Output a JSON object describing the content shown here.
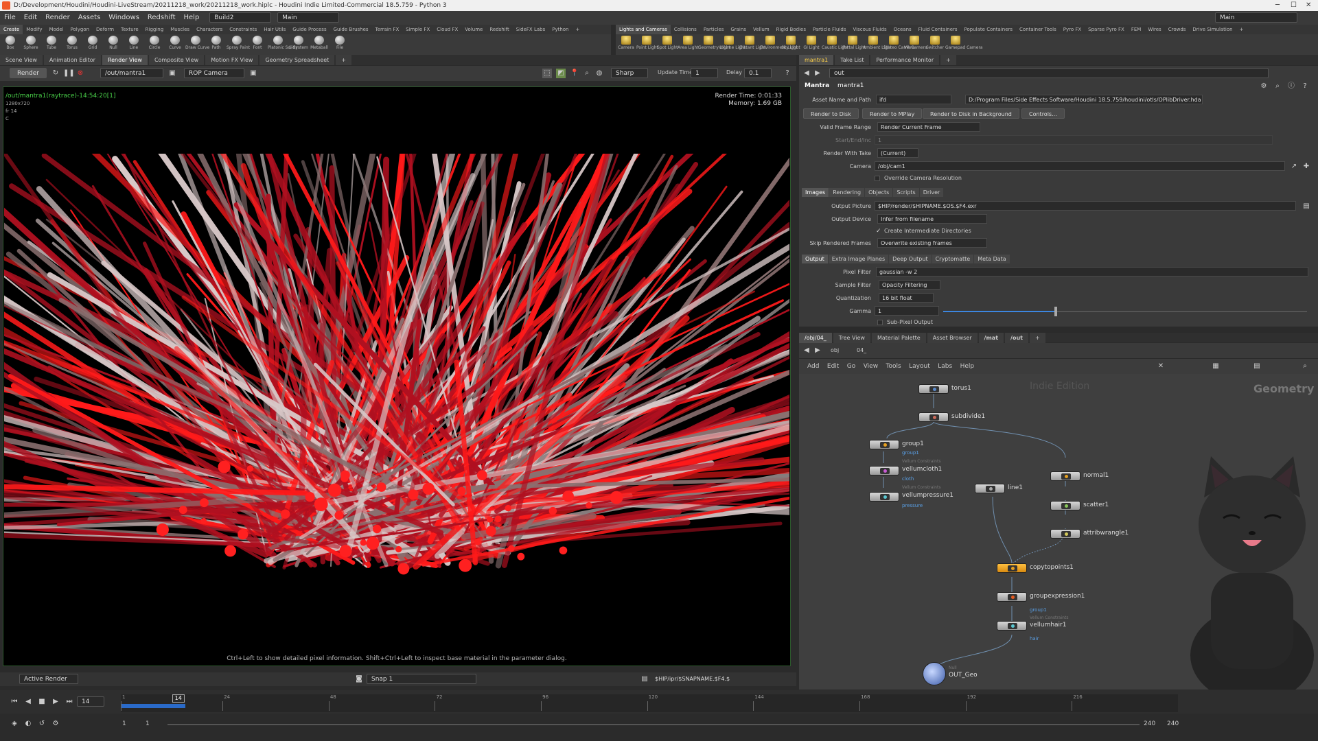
{
  "window": {
    "title": "D:/Development/Houdini/Houdini-LiveStream/20211218_work/20211218_work.hiplc - Houdini Indie Limited-Commercial 18.5.759 - Python 3"
  },
  "menu": {
    "items": [
      "File",
      "Edit",
      "Render",
      "Assets",
      "Windows",
      "Redshift",
      "Help"
    ],
    "desktop": "Build2",
    "context": "Main",
    "right_desktop": "Main"
  },
  "shelf_tabs_left": [
    "Create",
    "Modify",
    "Model",
    "Polygon",
    "Deform",
    "Texture",
    "Rigging",
    "Muscles",
    "Characters",
    "Constraints",
    "Hair Utils",
    "Guide Process",
    "Guide Brushes",
    "Terrain FX",
    "Simple FX",
    "Cloud FX",
    "Volume",
    "Redshift",
    "SideFX Labs",
    "Python"
  ],
  "shelf_tabs_right": [
    "Lights and Cameras",
    "Collisions",
    "Particles",
    "Grains",
    "Vellum",
    "Rigid Bodies",
    "Particle Fluids",
    "Viscous Fluids",
    "Oceans",
    "Fluid Containers",
    "Populate Containers",
    "Container Tools",
    "Pyro FX",
    "Sparse Pyro FX",
    "FEM",
    "Wires",
    "Crowds",
    "Drive Simulation"
  ],
  "shelf_tools_left": [
    "Box",
    "Sphere",
    "Tube",
    "Torus",
    "Grid",
    "Null",
    "Line",
    "Circle",
    "Curve",
    "Draw Curve",
    "Path",
    "Spray Paint",
    "Font",
    "Platonic Solids",
    "L-System",
    "Metaball",
    "File"
  ],
  "shelf_tools_right": [
    "Camera",
    "Point Light",
    "Spot Light",
    "Area Light",
    "Geometry Light",
    "Volume Light",
    "Distant Light",
    "Environment Light",
    "Sky Light",
    "GI Light",
    "Caustic Light",
    "Portal Light",
    "Ambient Light",
    "Stereo Camera",
    "VR Camera",
    "Switcher",
    "Gamepad Camera"
  ],
  "pane_tabs_left": [
    "Scene View",
    "Animation Editor",
    "Render View",
    "Composite View",
    "Motion FX View",
    "Geometry Spreadsheet"
  ],
  "pane_tabs_right": [
    "mantra1",
    "Take List",
    "Performance Monitor"
  ],
  "viewer": {
    "render_label": "Render",
    "rop_path": "/out/mantra1",
    "camera": "ROP Camera",
    "sharp": "Sharp",
    "update_time_label": "Update Time",
    "update_time": "1",
    "delay_label": "Delay",
    "delay": "0.1",
    "info_line1": "/out/mantra1(raytrace)-14:54:20[1]",
    "info_line2": "1280x720",
    "info_line3": "fr 14",
    "info_line4": "C",
    "render_time": "Render Time: 0:01:33",
    "memory": "Memory:      1.69 GB",
    "hint": "Ctrl+Left to show detailed pixel information. Shift+Ctrl+Left to inspect base material in the parameter dialog.",
    "footer_mode": "Active Render",
    "snap": "Snap 1",
    "ipr_path": "$HIP/ipr/$SNAPNAME.$F4.$"
  },
  "params": {
    "path": "out",
    "node_type": "Mantra",
    "node_name": "mantra1",
    "asset_label": "Asset Name and Path",
    "asset_value": "ifd",
    "asset_path": "D:/Program Files/Side Effects Software/Houdini 18.5.759/houdini/otls/OPlibDriver.hda",
    "buttons": [
      "Render to Disk",
      "Render to MPlay",
      "Render to Disk in Background",
      "Controls..."
    ],
    "rows": [
      {
        "label": "Valid Frame Range",
        "value": "Render Current Frame"
      },
      {
        "label": "Start/End/Inc",
        "value": "1"
      },
      {
        "label": "Render With Take",
        "value": "(Current)"
      },
      {
        "label": "Camera",
        "value": "/obj/cam1"
      }
    ],
    "override_cam": "Override Camera Resolution",
    "tabs1": [
      "Images",
      "Rendering",
      "Objects",
      "Scripts",
      "Driver"
    ],
    "output_picture_label": "Output Picture",
    "output_picture": "$HIP/render/$HIPNAME.$OS.$F4.exr",
    "output_device_label": "Output Device",
    "output_device": "Infer from filename",
    "create_dirs": "Create Intermediate Directories",
    "skip_label": "Skip Rendered Frames",
    "skip_value": "Overwrite existing frames",
    "tabs2": [
      "Output",
      "Extra Image Planes",
      "Deep Output",
      "Cryptomatte",
      "Meta Data"
    ],
    "pixel_filter_label": "Pixel Filter",
    "pixel_filter": "gaussian -w 2",
    "sample_filter_label": "Sample Filter",
    "sample_filter": "Opacity Filtering",
    "quant_label": "Quantization",
    "quant": "16 bit float",
    "gamma_label": "Gamma",
    "gamma": "1",
    "gamma_level": 0.31,
    "subpixel": "Sub-Pixel Output"
  },
  "net": {
    "tabs": [
      "/obj/04_",
      "Tree View",
      "Material Palette",
      "Asset Browser",
      "/mat",
      "/out"
    ],
    "path1": "obj",
    "path2": "04_",
    "menu": [
      "Add",
      "Edit",
      "Go",
      "View",
      "Tools",
      "Layout",
      "Labs",
      "Help"
    ],
    "watermark": "Indie Edition",
    "context": "Geometry",
    "nodes": {
      "torus": "torus1",
      "subdivide": "subdivide1",
      "group": "group1",
      "group_sub": "group1",
      "vellumcloth": "vellumcloth1",
      "vellumcloth_type": "Vellum Constraints",
      "vellumcloth_sub": "cloth",
      "vellumpressure": "vellumpressure1",
      "vellumpressure_type": "Vellum Constraints",
      "vellumpressure_sub": "pressure",
      "line": "line1",
      "normal": "normal1",
      "scatter": "scatter1",
      "attribwrangle": "attribwrangle1",
      "copytopoints": "copytopoints1",
      "groupexpression": "groupexpression1",
      "groupexpression_sub": "group1",
      "vellumhair": "vellumhair1",
      "vellumhair_type": "Vellum Constraints",
      "vellumhair_sub": "hair",
      "out": "OUT_Geo",
      "out_type": "Null"
    }
  },
  "timeline": {
    "frame": "14",
    "ticks": [
      "1",
      "24",
      "48",
      "72",
      "96",
      "120",
      "144",
      "168",
      "192",
      "216"
    ],
    "start1": "1",
    "start2": "1",
    "end1": "240",
    "end2": "240"
  },
  "colors": {
    "accent": "#e6a020",
    "link": "#5aa0e6",
    "render_red": "#e8101a"
  }
}
